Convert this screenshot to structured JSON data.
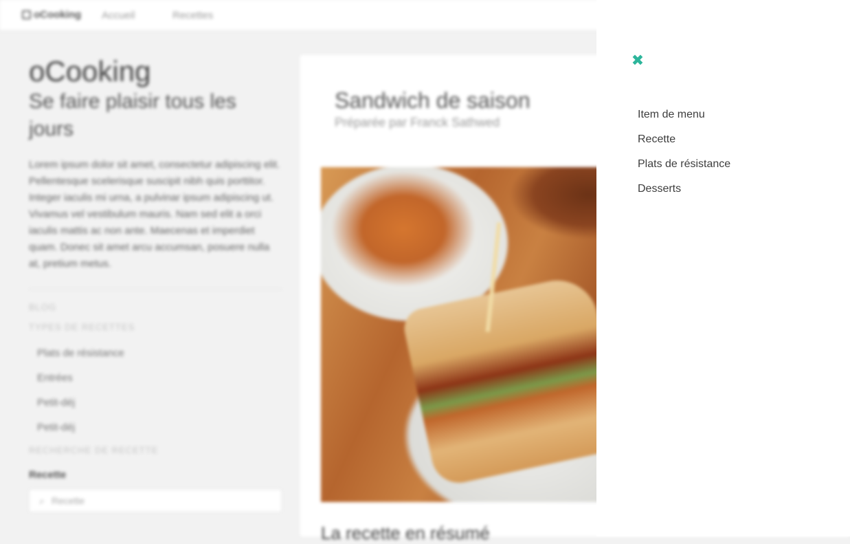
{
  "topbar": {
    "brand": "oCooking",
    "nav": [
      "Accueil",
      "Recettes"
    ]
  },
  "sidebar": {
    "title": "oCooking",
    "tagline": "Se faire plaisir tous les jours",
    "intro": "Lorem ipsum dolor sit amet, consectetur adipiscing elit. Pellentesque scelerisque suscipit nibh quis porttitor. Integer iaculis mi urna, a pulvinar ipsum adipiscing ut. Vivamus vel vestibulum mauris. Nam sed elit a orci iaculis mattis ac non ante. Maecenas et imperdiet quam. Donec sit amet arcu accumsan, posuere nulla at, pretium metus.",
    "blog_label": "BLOG",
    "types_label": "TYPES DE RECETTES",
    "categories": [
      "Plats de résistance",
      "Entrées",
      "Petit-déj",
      "Petit-déj"
    ],
    "search_section_label": "RECHERCHE DE RECETTE",
    "search_label": "Recette",
    "search_placeholder": "Recette"
  },
  "recipe": {
    "title": "Sandwich de saison",
    "author": "Préparée par Franck Sathwed",
    "summary_heading": "La recette en résumé"
  },
  "drawer": {
    "close_glyph": "✖",
    "items": [
      "Item de menu",
      "Recette",
      "Plats de résistance",
      "Desserts"
    ]
  },
  "colors": {
    "accent": "#2cb59b",
    "drawer_text": "#3d3d3d",
    "page_bg": "#f2f2f2"
  }
}
